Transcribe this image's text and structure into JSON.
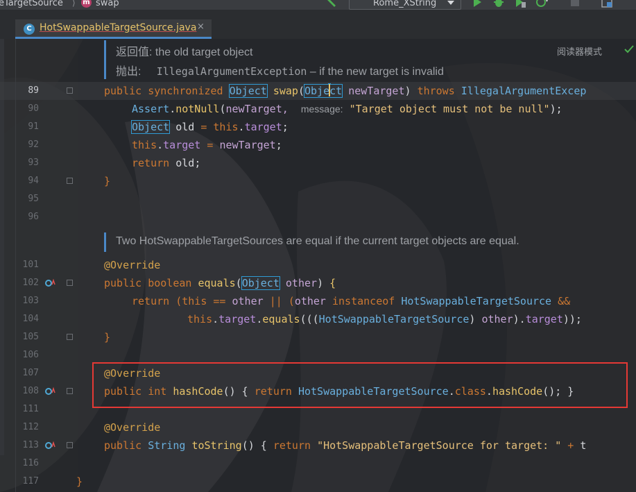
{
  "navbar": {
    "breadcrumb_class": "eTargetSource",
    "breadcrumb_separator": "⟩",
    "breadcrumb_method_icon": "m",
    "breadcrumb_method": "swap",
    "run_config": "Rome_XString",
    "icons": [
      "hammer-icon",
      "run-icon",
      "debug-icon",
      "coverage-icon",
      "profile-icon",
      "stop-icon",
      "layout-icon"
    ]
  },
  "tab": {
    "title": "HotSwappableTargetSource.java",
    "close": "×",
    "icon": "C"
  },
  "reader_mode": "阅读器模式",
  "doc_returns": {
    "label": "返回值:",
    "text": "the old target object"
  },
  "doc_throws": {
    "label": "抛出:",
    "exception": "IllegalArgumentException",
    "text": "– if the new target is invalid"
  },
  "doc_equals": "Two HotSwappableTargetSources are equal if the current target objects are equal.",
  "line_numbers": [
    "89",
    "90",
    "91",
    "92",
    "93",
    "94",
    "95",
    "96",
    "101",
    "102",
    "103",
    "104",
    "105",
    "106",
    "107",
    "108",
    "111",
    "112",
    "113",
    "116",
    "117"
  ],
  "code": {
    "l89": {
      "k1": "public",
      "k2": "synchronized",
      "t1": "Object",
      "f": "swap",
      "t2a": "Obje",
      "t2b": "ct",
      "p": "newTarget",
      "k3": "throws",
      "ex": "IllegalArgumentExcep"
    },
    "l90": {
      "cls": "Assert",
      "fn": "notNull",
      "arg": "newTarget,",
      "hint": "message:",
      "str": "\"Target object must not be null\""
    },
    "l91": {
      "t": "Object",
      "v": "old",
      "eq": "=",
      "k": "this",
      "f": "target"
    },
    "l92": {
      "k": "this",
      "f": "target",
      "eq": "=",
      "v": "newTarget"
    },
    "l93": {
      "k": "return",
      "v": "old"
    },
    "brace_close": "}",
    "ann": "@Override",
    "l102": {
      "k1": "public",
      "k2": "boolean",
      "f": "equals",
      "t": "Object",
      "p": "other"
    },
    "l103": {
      "k": "return",
      "a": "this",
      "op1": "==",
      "b": "other",
      "op2": "||",
      "c": "other",
      "k2": "instanceof",
      "t": "HotSwappableTargetSource",
      "op3": "&&"
    },
    "l104": {
      "k": "this",
      "f": "target",
      "fn": "equals",
      "t": "HotSwappableTargetSource",
      "v": "other",
      "f2": "target"
    },
    "l108": {
      "k1": "public",
      "k2": "int",
      "f": "hashCode",
      "k3": "return",
      "t": "HotSwappableTargetSource",
      "k4": "class",
      "f2": "hashCode"
    },
    "l113": {
      "k1": "public",
      "t": "String",
      "f": "toString",
      "k2": "return",
      "str": "\"HotSwappableTargetSource for target: \"",
      "op": "+",
      "tail": "t"
    }
  },
  "colors": {
    "background": "#25272b",
    "keyword": "#cc7832",
    "type": "#6ab0de",
    "method": "#e8c46a",
    "highlight_box": "#e53935",
    "tab_underline": "#4a88c7"
  }
}
